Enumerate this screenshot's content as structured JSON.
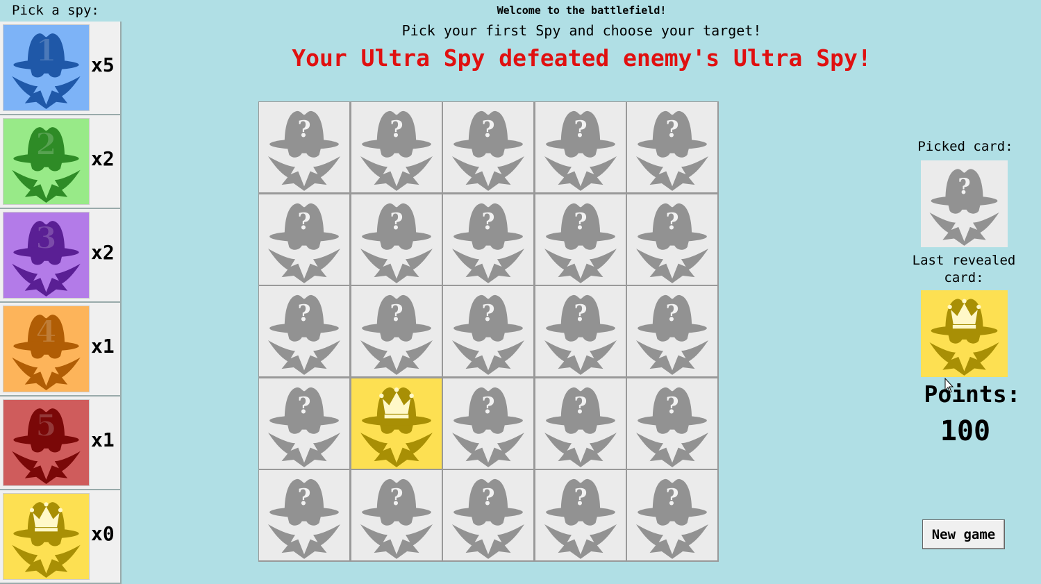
{
  "sidebar": {
    "title": "Pick a spy:",
    "spies": [
      {
        "mark": "1",
        "count": "x5",
        "bg": "#7db3f7",
        "fg": "#1f58a8"
      },
      {
        "mark": "2",
        "count": "x2",
        "bg": "#98ea88",
        "fg": "#2e8b26"
      },
      {
        "mark": "3",
        "count": "x2",
        "bg": "#b37be8",
        "fg": "#5a1f94"
      },
      {
        "mark": "4",
        "count": "x1",
        "bg": "#fdb45a",
        "fg": "#b05d05"
      },
      {
        "mark": "5",
        "count": "x1",
        "bg": "#cf5c5c",
        "fg": "#7a0808"
      },
      {
        "mark": "crown",
        "count": "x0",
        "bg": "#fde052",
        "fg": "#a88f05"
      }
    ]
  },
  "header": {
    "welcome": "Welcome to the battlefield!",
    "instruction": "Pick your first Spy and choose your target!",
    "result": "Your Ultra Spy defeated enemy's Ultra Spy!"
  },
  "board": {
    "rows": 5,
    "cols": 5,
    "hidden_color": "#929292",
    "revealed": [
      {
        "row": 3,
        "col": 1,
        "mark": "crown",
        "bg": "#fde052",
        "fg": "#a88f05"
      }
    ]
  },
  "side_panel": {
    "picked_label": "Picked card:",
    "last_revealed_label": "Last revealed card:",
    "points_label": "Points:",
    "points": "100",
    "new_game_label": "New game"
  }
}
